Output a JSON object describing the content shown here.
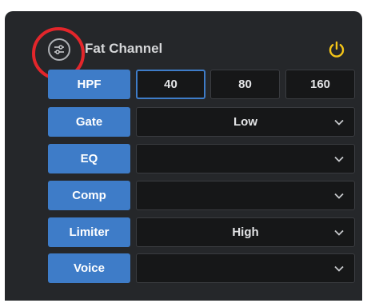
{
  "header": {
    "title": "Fat Channel",
    "settings_icon": "sliders-icon",
    "power_icon": "power-icon",
    "power_color": "#f5c518"
  },
  "annotation": {
    "ring_color": "#e3262b"
  },
  "hpf": {
    "label": "HPF",
    "options": [
      "40",
      "80",
      "160"
    ],
    "selected": "40"
  },
  "rows": [
    {
      "label": "Gate",
      "value": "Low"
    },
    {
      "label": "EQ",
      "value": ""
    },
    {
      "label": "Comp",
      "value": ""
    },
    {
      "label": "Limiter",
      "value": "High"
    },
    {
      "label": "Voice",
      "value": ""
    }
  ],
  "colors": {
    "panel_bg": "#25272a",
    "button_blue": "#3e7cc8",
    "field_bg": "#161718"
  }
}
